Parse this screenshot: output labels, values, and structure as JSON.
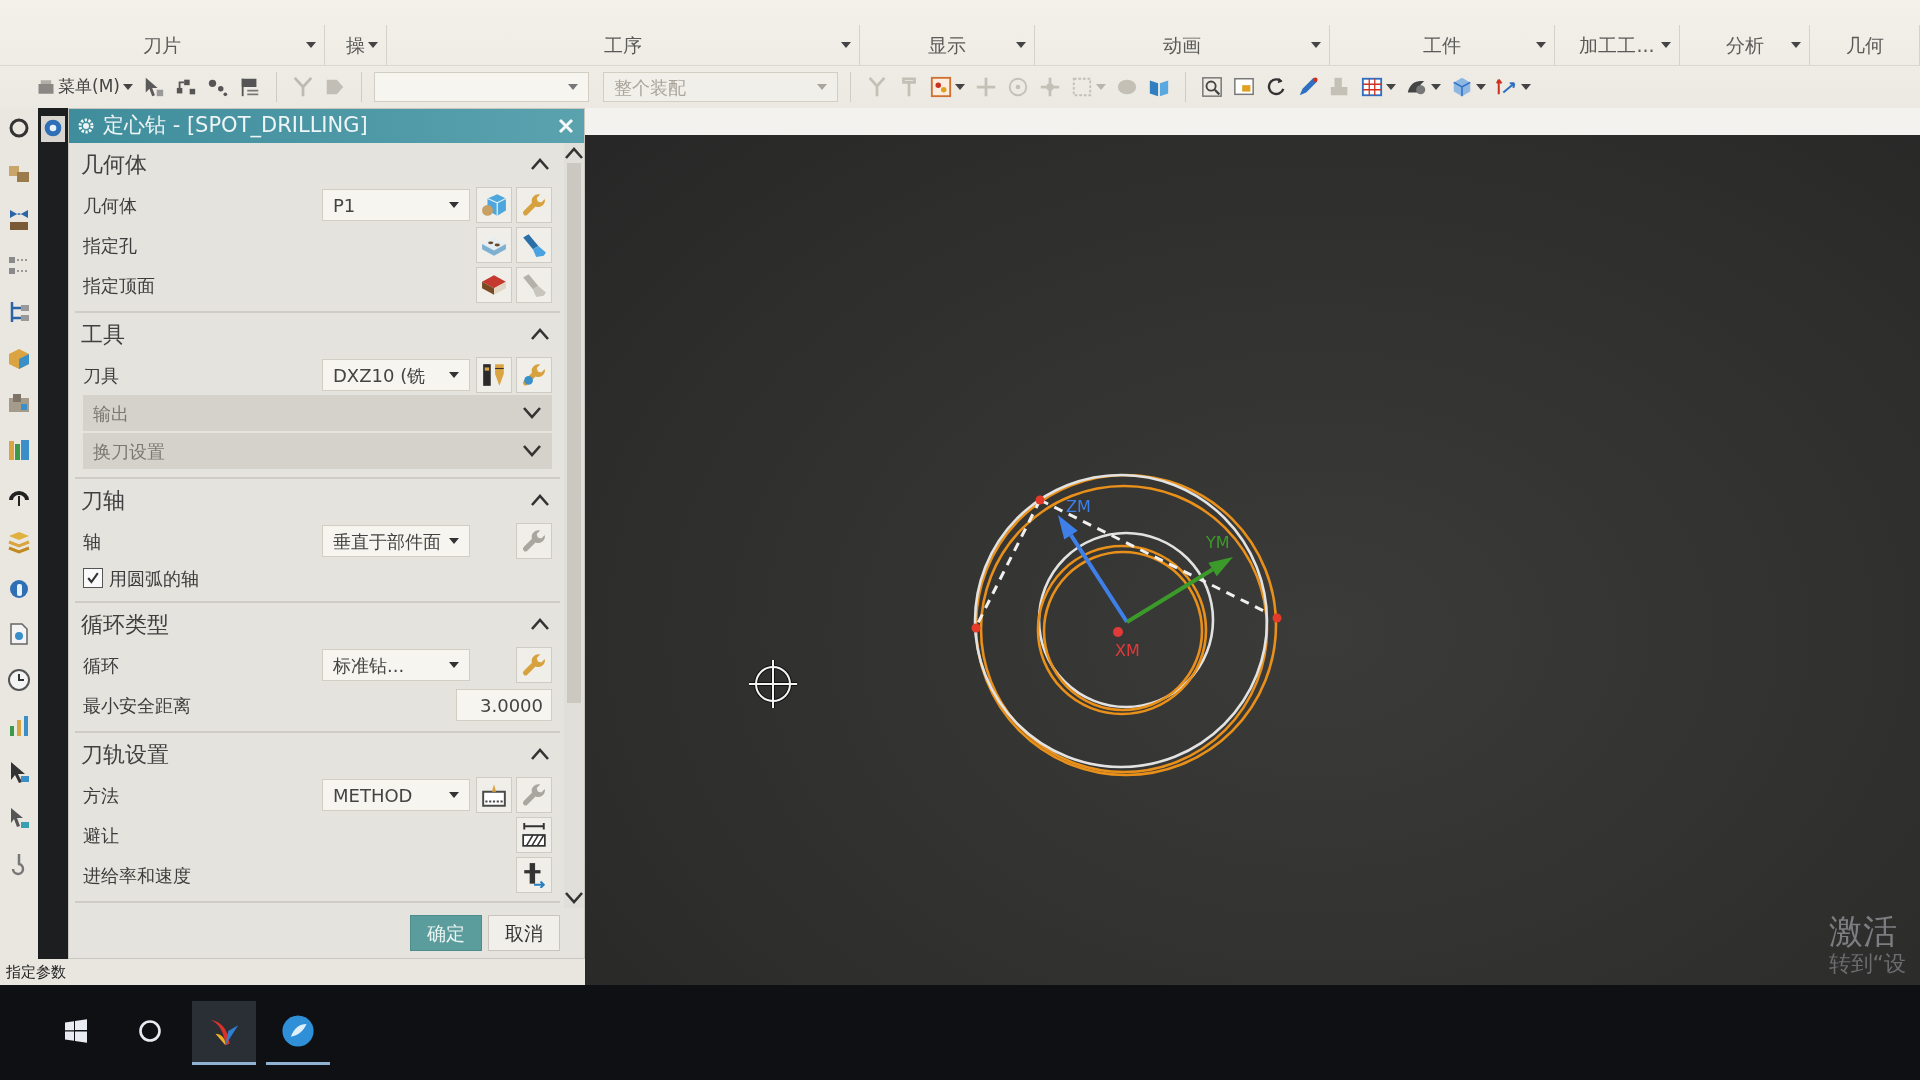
{
  "ribbon": {
    "groups": [
      {
        "label": "刀片",
        "dropdown": true
      },
      {
        "label": "操",
        "dropdown": true
      },
      {
        "label": "工序",
        "dropdown": true
      },
      {
        "label": "显示",
        "dropdown": true
      },
      {
        "label": "动画",
        "dropdown": true
      },
      {
        "label": "工件",
        "dropdown": true
      },
      {
        "label": "加工工...",
        "dropdown": true
      },
      {
        "label": "分析",
        "dropdown": true
      },
      {
        "label": "几何",
        "dropdown": false
      }
    ]
  },
  "toolbar": {
    "menu_label": "菜单(M)",
    "scope": {
      "value": "整个装配",
      "disabled": true
    }
  },
  "dialog": {
    "title": "定心钻 - [SPOT_DRILLING]",
    "sections": [
      {
        "title": "几何体",
        "expanded": true,
        "rows": [
          {
            "kind": "select",
            "label": "几何体",
            "value": "P1"
          },
          {
            "kind": "action",
            "label": "指定孔"
          },
          {
            "kind": "action",
            "label": "指定顶面"
          }
        ]
      },
      {
        "title": "工具",
        "expanded": true,
        "rows": [
          {
            "kind": "select",
            "label": "刀具",
            "value": "DXZ10 (铣"
          },
          {
            "kind": "group",
            "label": "输出",
            "expanded": false
          },
          {
            "kind": "group",
            "label": "换刀设置",
            "expanded": false
          }
        ]
      },
      {
        "title": "刀轴",
        "expanded": true,
        "rows": [
          {
            "kind": "select",
            "label": "轴",
            "value": "垂直于部件面"
          },
          {
            "kind": "checkbox",
            "label": "用圆弧的轴",
            "checked": true
          }
        ]
      },
      {
        "title": "循环类型",
        "expanded": true,
        "rows": [
          {
            "kind": "select",
            "label": "循环",
            "value": "标准钻..."
          },
          {
            "kind": "number",
            "label": "最小安全距离",
            "value": "3.0000"
          }
        ]
      },
      {
        "title": "刀轨设置",
        "expanded": true,
        "rows": [
          {
            "kind": "select",
            "label": "方法",
            "value": "METHOD"
          },
          {
            "kind": "action",
            "label": "避让"
          },
          {
            "kind": "action",
            "label": "进给率和速度"
          }
        ]
      }
    ],
    "buttons": [
      {
        "label": "确定",
        "kind": "primary"
      },
      {
        "label": "取消",
        "kind": "secondary"
      }
    ]
  },
  "status_bar": {
    "text": "指定参数"
  },
  "viewport": {
    "axes": [
      {
        "label": "ZM",
        "color": "#3f7fe8",
        "kind": "arrow"
      },
      {
        "label": "YM",
        "color": "#3c9a2a",
        "kind": "arrow"
      },
      {
        "label": "XM",
        "color": "#e03a3a",
        "kind": "point"
      }
    ]
  },
  "activation_notice": {
    "title": "激活",
    "text": "转到“设"
  },
  "taskbar": {
    "apps": [
      {
        "selected": true,
        "running": true
      },
      {
        "selected": false,
        "running": true
      }
    ]
  }
}
